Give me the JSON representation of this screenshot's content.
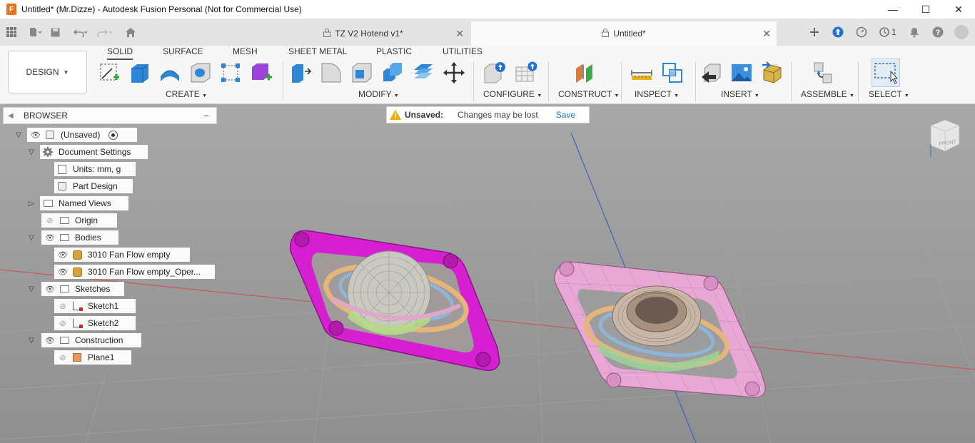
{
  "window": {
    "title": "Untitled* (Mr.Dizze) - Autodesk Fusion Personal (Not for Commercial Use)",
    "controls": [
      "—",
      "☐",
      "✕"
    ]
  },
  "tabs": [
    {
      "label": "TZ V2 Hotend v1*",
      "active": false
    },
    {
      "label": "Untitled*",
      "active": true
    }
  ],
  "header_right": {
    "job_count": "1"
  },
  "workspace": {
    "label": "DESIGN"
  },
  "toolbar_tabs": [
    "SOLID",
    "SURFACE",
    "MESH",
    "SHEET METAL",
    "PLASTIC",
    "UTILITIES"
  ],
  "groups": {
    "create": "CREATE",
    "modify": "MODIFY",
    "configure": "CONFIGURE",
    "construct": "CONSTRUCT",
    "inspect": "INSPECT",
    "insert": "INSERT",
    "assemble": "ASSEMBLE",
    "select": "SELECT"
  },
  "browser": {
    "title": "BROWSER",
    "items": [
      {
        "label": "(Unsaved)"
      },
      {
        "label": "Document Settings"
      },
      {
        "label": "Units: mm, g"
      },
      {
        "label": "Part Design"
      },
      {
        "label": "Named Views"
      },
      {
        "label": "Origin"
      },
      {
        "label": "Bodies"
      },
      {
        "label": "3010 Fan Flow empty"
      },
      {
        "label": "3010 Fan Flow empty_Oper..."
      },
      {
        "label": "Sketches"
      },
      {
        "label": "Sketch1"
      },
      {
        "label": "Sketch2"
      },
      {
        "label": "Construction"
      },
      {
        "label": "Plane1"
      }
    ]
  },
  "notice": {
    "status": "Unsaved:",
    "message": "Changes may be lost",
    "action": "Save"
  },
  "viewcube": {
    "face": "FRONT"
  },
  "colors": {
    "accent": "#1e73d8",
    "body_magenta": "#d61fd0",
    "body_pink": "#e9a7d6",
    "viewport_bg": "#9a9a9a"
  }
}
